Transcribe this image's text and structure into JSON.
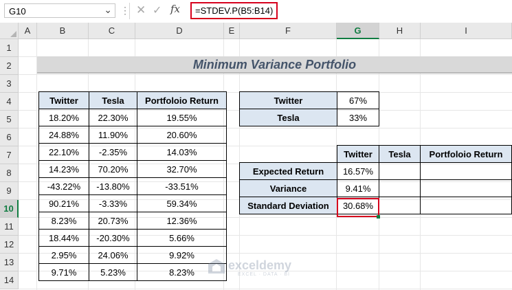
{
  "formula_bar": {
    "name_box": "G10",
    "formula": "=STDEV.P(B5:B14)"
  },
  "columns": [
    "A",
    "B",
    "C",
    "D",
    "E",
    "F",
    "G",
    "H",
    "I"
  ],
  "rows": [
    "1",
    "2",
    "3",
    "4",
    "5",
    "6",
    "7",
    "8",
    "9",
    "10",
    "11",
    "12",
    "13",
    "14"
  ],
  "selected_column": "G",
  "selected_row": "10",
  "title": "Minimum Variance Portfolio",
  "returns_table": {
    "headers": [
      "Twitter",
      "Tesla",
      "Portfoloio Return"
    ],
    "rows": [
      [
        "18.20%",
        "22.30%",
        "19.55%"
      ],
      [
        "24.88%",
        "11.90%",
        "20.60%"
      ],
      [
        "22.10%",
        "-2.35%",
        "14.03%"
      ],
      [
        "14.23%",
        "70.20%",
        "32.70%"
      ],
      [
        "-43.22%",
        "-13.80%",
        "-33.51%"
      ],
      [
        "90.21%",
        "-3.33%",
        "59.34%"
      ],
      [
        "8.23%",
        "20.73%",
        "12.36%"
      ],
      [
        "18.44%",
        "-20.30%",
        "5.66%"
      ],
      [
        "2.95%",
        "24.06%",
        "9.92%"
      ],
      [
        "9.71%",
        "5.23%",
        "8.23%"
      ]
    ]
  },
  "weights_table": {
    "rows": [
      [
        "Twitter",
        "67%"
      ],
      [
        "Tesla",
        "33%"
      ]
    ]
  },
  "stats_table": {
    "headers": [
      "Twitter",
      "Tesla",
      "Portfoloio Return"
    ],
    "rows": [
      {
        "label": "Expected Return",
        "twitter": "16.57%",
        "tesla": "",
        "portfolio": ""
      },
      {
        "label": "Variance",
        "twitter": "9.41%",
        "tesla": "",
        "portfolio": ""
      },
      {
        "label": "Standard Deviation",
        "twitter": "30.68%",
        "tesla": "",
        "portfolio": ""
      }
    ]
  },
  "watermark": {
    "brand": "exceldemy",
    "tagline": "EXCEL · DATA · BI"
  },
  "colors": {
    "header_fill": "#dce6f1",
    "highlight": "#d6001c",
    "excel_green": "#107c41",
    "title_text": "#44546a"
  }
}
